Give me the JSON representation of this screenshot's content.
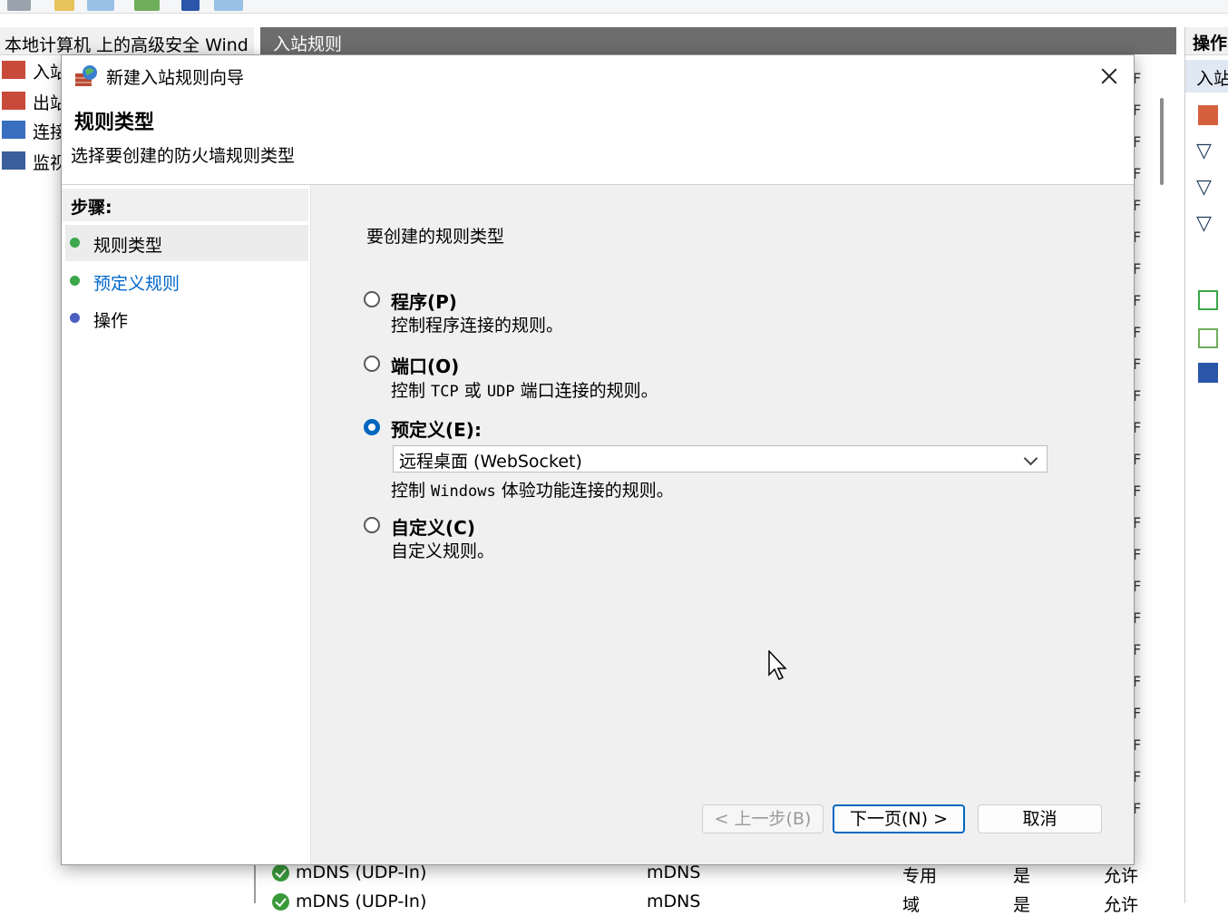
{
  "mmc": {
    "tree_header": "本地计算机 上的高级安全 Wind",
    "tree_items": [
      "入站",
      "出站",
      "连接",
      "监视"
    ],
    "center_title": "入站规则",
    "rows": [
      {
        "name": "mDNS (UDP-In)",
        "group": "mDNS",
        "profile": "专用",
        "enabled": "是",
        "action": "允许"
      },
      {
        "name": "mDNS (UDP-In)",
        "group": "mDNS",
        "profile": "域",
        "enabled": "是",
        "action": "允许"
      }
    ],
    "actions_header": "操作",
    "actions_sub": "入站",
    "truncated_col_char": "F"
  },
  "dialog": {
    "title": "新建入站规则向导",
    "header_title": "规则类型",
    "header_subtitle": "选择要创建的防火墙规则类型",
    "steps_title": "步骤:",
    "steps": [
      {
        "label": "规则类型",
        "color": "#3aa84a",
        "active": true
      },
      {
        "label": "预定义规则",
        "color": "#3aa84a",
        "active": false
      },
      {
        "label": "操作",
        "color": "#4a5fc0",
        "active": false
      }
    ],
    "prompt": "要创建的规则类型",
    "options": [
      {
        "label": "程序(P)",
        "desc": "控制程序连接的规则。",
        "checked": false
      },
      {
        "label": "端口(O)",
        "desc_parts": [
          "控制 ",
          "TCP",
          " 或 ",
          "UDP",
          " 端口连接的规则。"
        ],
        "checked": false
      },
      {
        "label": "预定义(E):",
        "desc_parts": [
          "控制 ",
          "Windows",
          " 体验功能连接的规则。"
        ],
        "checked": true
      },
      {
        "label": "自定义(C)",
        "desc": "自定义规则。",
        "checked": false
      }
    ],
    "predefined_selected": "远程桌面 (WebSocket)",
    "buttons": {
      "back": "< 上一步(B)",
      "next": "下一页(N) >",
      "cancel": "取消"
    }
  }
}
